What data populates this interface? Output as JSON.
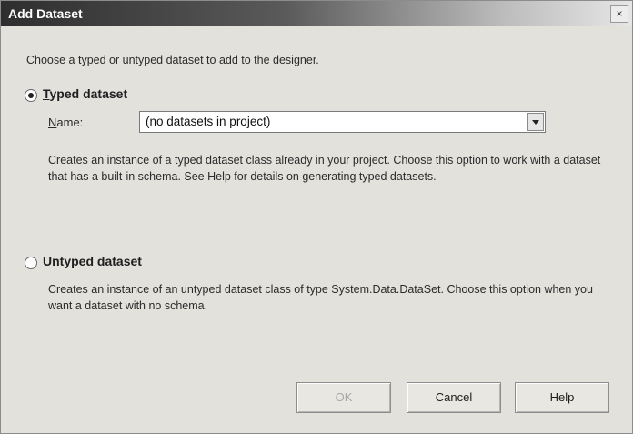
{
  "window": {
    "title": "Add Dataset",
    "close_label": "×"
  },
  "intro": "Choose a typed or untyped dataset to add to the designer.",
  "typed": {
    "label_mnemonic": "T",
    "label_rest": "yped dataset",
    "selected": true,
    "name_label_mnemonic": "N",
    "name_label_rest": "ame:",
    "name_value": "(no datasets in project)",
    "description": "Creates an instance of a typed dataset class already in your project. Choose this option to work with a dataset that has a built-in schema. See Help for details on generating typed datasets."
  },
  "untyped": {
    "label_mnemonic": "U",
    "label_rest": "ntyped dataset",
    "selected": false,
    "description": "Creates an instance of an untyped dataset class of type System.Data.DataSet. Choose this option when you want a dataset with no schema."
  },
  "buttons": {
    "ok": "OK",
    "cancel": "Cancel",
    "help": "Help"
  }
}
